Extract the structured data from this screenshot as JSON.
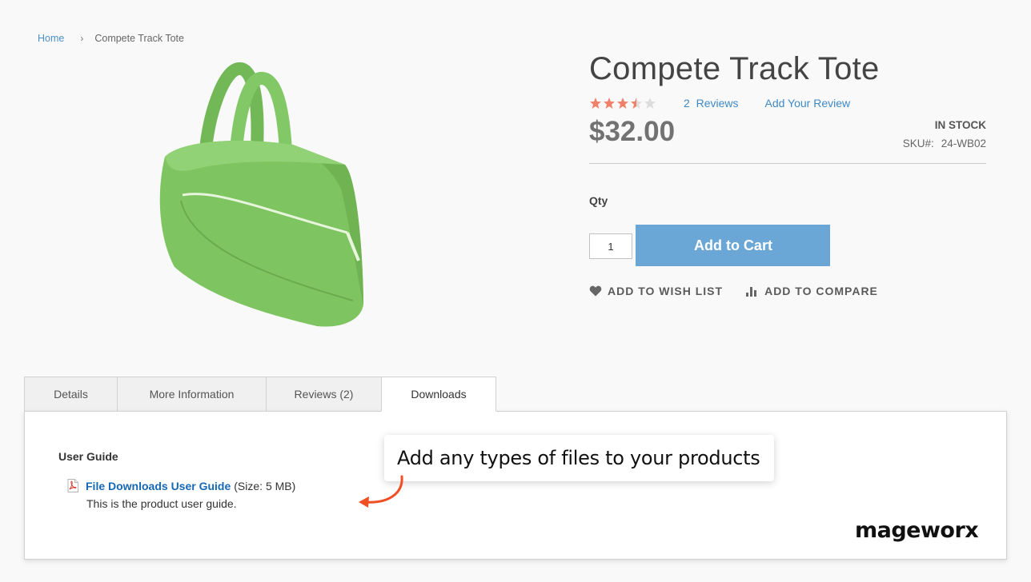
{
  "breadcrumb": {
    "home": "Home",
    "current": "Compete Track Tote"
  },
  "product": {
    "title": "Compete Track Tote",
    "rating_percent": 70,
    "reviews_count": "2",
    "reviews_label": "Reviews",
    "add_review": "Add Your Review",
    "price": "$32.00",
    "stock": "IN STOCK",
    "sku_label": "SKU#:",
    "sku_value": "24-WB02",
    "qty_label": "Qty",
    "qty_value": "1",
    "add_to_cart": "Add to Cart",
    "wishlist": "ADD TO WISH LIST",
    "compare": "ADD TO COMPARE"
  },
  "tabs": [
    "Details",
    "More Information",
    "Reviews (2)",
    "Downloads"
  ],
  "active_tab": "Downloads",
  "downloads": {
    "section_title": "User Guide",
    "file_name": "File Downloads User Guide",
    "file_size": "(Size: 5 MB)",
    "file_description": "This is the product user guide."
  },
  "callout": "Add any types of files to your products",
  "brand": "mageworx",
  "colors": {
    "star": "#f0806a",
    "link": "#3f89c4",
    "button": "#6aa6d6",
    "arrow": "#f04e23",
    "bag": "#7ec460"
  }
}
